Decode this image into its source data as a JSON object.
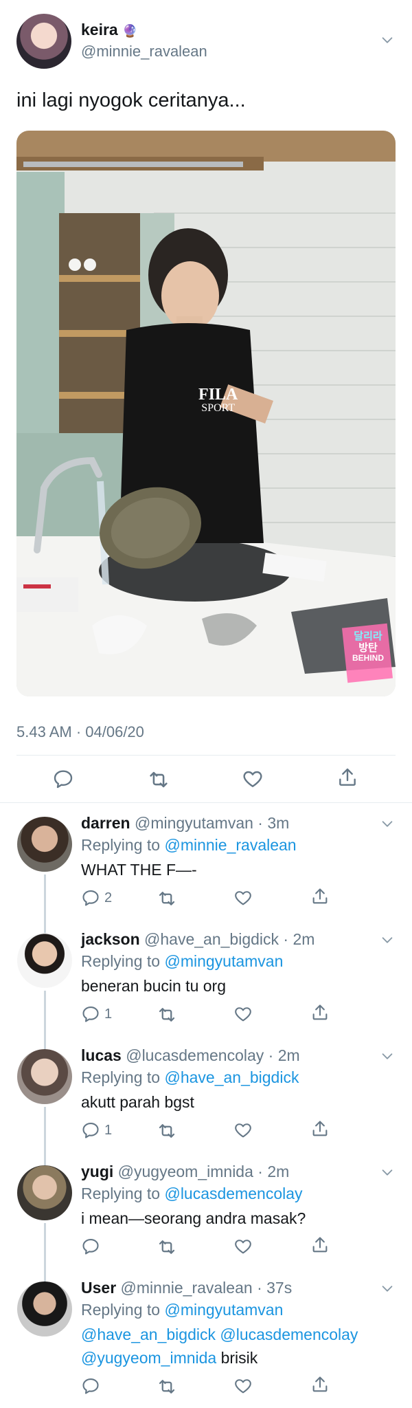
{
  "tweet": {
    "author_name": "keira",
    "author_emoji": "🔮",
    "author_handle": "@minnie_ravalean",
    "text": "ini lagi nyogok ceritanya...",
    "timestamp": "5.43 AM · 04/06/20",
    "photo_shirt_text_1": "FILA",
    "photo_shirt_text_2": "SPORT",
    "photo_sticker_1": "달리라",
    "photo_sticker_2": "방탄",
    "photo_sticker_3": "BEHIND"
  },
  "replies": [
    {
      "name": "darren",
      "handle": "@mingyutamvan",
      "time": "· 3m",
      "replying_prefix": "Replying to",
      "replying_to": "@minnie_ravalean",
      "text": "WHAT THE F—-",
      "reply_count": "2"
    },
    {
      "name": "jackson",
      "handle": "@have_an_bigdick",
      "time": "· 2m",
      "replying_prefix": "Replying to",
      "replying_to": "@mingyutamvan",
      "text": "beneran bucin tu org",
      "reply_count": "1"
    },
    {
      "name": "lucas",
      "handle": "@lucasdemencolay",
      "time": "· 2m",
      "replying_prefix": "Replying to",
      "replying_to": "@have_an_bigdick",
      "text": "akutt parah bgst",
      "reply_count": "1"
    },
    {
      "name": "yugi",
      "handle": "@yugyeom_imnida",
      "time": "· 2m",
      "replying_prefix": "Replying to",
      "replying_to": "@lucasdemencolay",
      "text": "i mean—seorang andra masak?",
      "reply_count": ""
    },
    {
      "name": "User",
      "handle": "@minnie_ravalean",
      "time": "· 37s",
      "replying_prefix": "Replying to",
      "replying_to": "@mingyutamvan",
      "mention_line_1": "@have_an_bigdick @lucasdemencolay",
      "mention_line_2": "@yugyeom_imnida",
      "text": "brisik",
      "reply_count": ""
    }
  ],
  "colors": {
    "link": "#1b95e0",
    "muted": "#657786",
    "divider": "#e6ecf0"
  },
  "icons": [
    "chevron-down-icon",
    "reply-icon",
    "retweet-icon",
    "like-icon",
    "share-icon"
  ]
}
